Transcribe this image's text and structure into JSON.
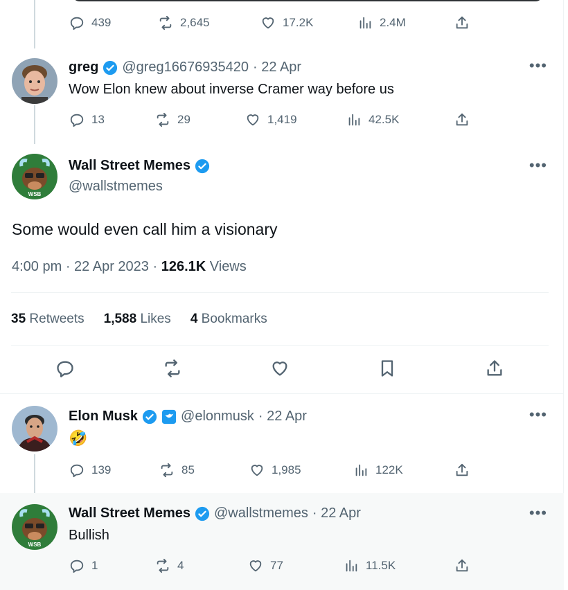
{
  "top_actions": {
    "reply": "439",
    "retweet": "2,645",
    "like": "17.2K",
    "views": "2.4M"
  },
  "reply1": {
    "name": "greg",
    "handle": "@greg16676935420",
    "date": "· 22 Apr",
    "text": "Wow Elon knew about inverse Cramer way before us",
    "actions": {
      "reply": "13",
      "retweet": "29",
      "like": "1,419",
      "views": "42.5K"
    }
  },
  "main": {
    "name": "Wall Street Memes",
    "handle": "@wallstmemes",
    "avatar_label": "WSB",
    "text": "Some would even call him a visionary",
    "time": "4:00 pm · 22 Apr 2023 ·",
    "views_count": "126.1K",
    "views_label": "Views",
    "stats": {
      "retweets_count": "35",
      "retweets_label": "Retweets",
      "likes_count": "1,588",
      "likes_label": "Likes",
      "bookmarks_count": "4",
      "bookmarks_label": "Bookmarks"
    }
  },
  "reply2": {
    "name": "Elon Musk",
    "handle": "@elonmusk",
    "date": "· 22 Apr",
    "text": "🤣",
    "actions": {
      "reply": "139",
      "retweet": "85",
      "like": "1,985",
      "views": "122K"
    }
  },
  "reply3": {
    "name": "Wall Street Memes",
    "handle": "@wallstmemes",
    "date": "· 22 Apr",
    "avatar_label": "WSB",
    "text": "Bullish",
    "actions": {
      "reply": "1",
      "retweet": "4",
      "like": "77",
      "views": "11.5K"
    }
  },
  "colors": {
    "verified": "#1d9bf0",
    "muted": "#536471",
    "text": "#0f1419"
  }
}
